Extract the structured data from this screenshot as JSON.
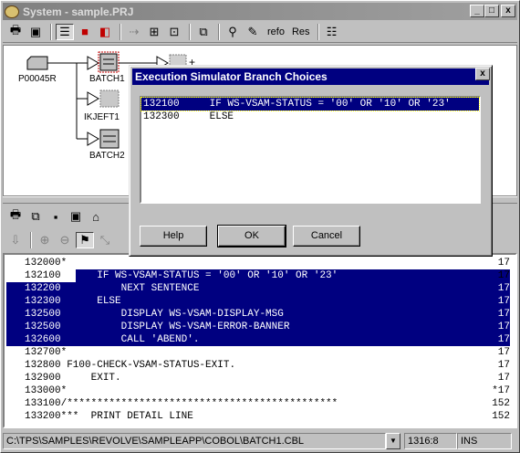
{
  "window": {
    "title": "System - sample.PRJ",
    "min_glyph": "_",
    "max_glyph": "□",
    "close_glyph": "x"
  },
  "toolbar": {
    "refo_label": "refo",
    "res_label": "Res"
  },
  "diagram": {
    "nodes": [
      {
        "label": "P00045R"
      },
      {
        "label": "BATCH1"
      },
      {
        "label": "IKJEFT1"
      },
      {
        "label": "BATCH2"
      }
    ]
  },
  "code": {
    "lines": [
      {
        "num": "132000*",
        "text": "",
        "right": "17"
      },
      {
        "num": "132100",
        "text": "      IF WS-VSAM-STATUS = '00' OR '10' OR '23'",
        "right": "17"
      },
      {
        "num": "132200",
        "text": "          NEXT SENTENCE",
        "right": "17"
      },
      {
        "num": "132300",
        "text": "      ELSE",
        "right": "17"
      },
      {
        "num": "132500",
        "text": "          DISPLAY WS-VSAM-DISPLAY-MSG",
        "right": "17"
      },
      {
        "num": "132500",
        "text": "          DISPLAY WS-VSAM-ERROR-BANNER",
        "right": "17"
      },
      {
        "num": "132600",
        "text": "          CALL 'ABEND'.",
        "right": "17"
      },
      {
        "num": "132700*",
        "text": "",
        "right": "17"
      },
      {
        "num": "132800",
        "text": " F100-CHECK-VSAM-STATUS-EXIT.",
        "right": "17"
      },
      {
        "num": "132900",
        "text": "     EXIT.",
        "right": "17"
      },
      {
        "num": "133000*",
        "text": "",
        "right": "*17"
      },
      {
        "num": "133100",
        "text": "/*********************************************",
        "right": "152"
      },
      {
        "num": "133200",
        "text": "***  PRINT DETAIL LINE",
        "right": "152"
      }
    ]
  },
  "status": {
    "path": "C:\\TPS\\SAMPLES\\REVOLVE\\SAMPLEAPP\\COBOL\\BATCH1.CBL",
    "position": "1316:8",
    "mode": "INS"
  },
  "dialog": {
    "title": "Execution Simulator Branch Choices",
    "close_glyph": "x",
    "items": [
      {
        "num": "132100",
        "text": "IF WS-VSAM-STATUS = '00' OR '10' OR '23'"
      },
      {
        "num": "132300",
        "text": "ELSE"
      }
    ],
    "help_label": "Help",
    "ok_label": "OK",
    "cancel_label": "Cancel"
  }
}
